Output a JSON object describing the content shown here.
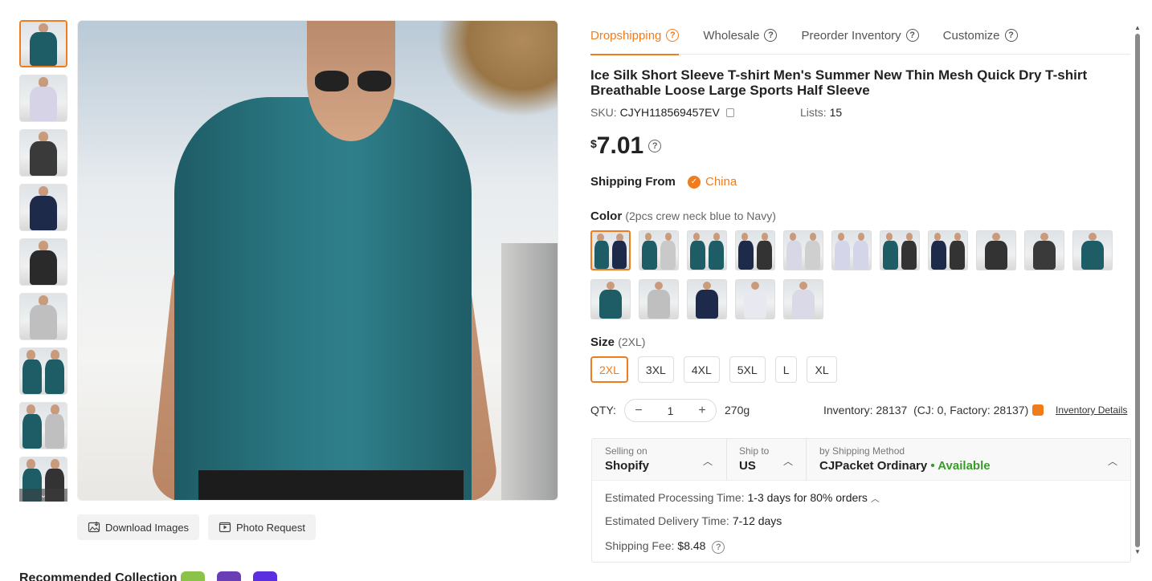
{
  "tabs": [
    {
      "label": "Dropshipping"
    },
    {
      "label": "Wholesale"
    },
    {
      "label": "Preorder Inventory"
    },
    {
      "label": "Customize"
    }
  ],
  "product": {
    "title": "Ice Silk Short Sleeve T-shirt Men's Summer New Thin Mesh Quick Dry T-shirt Breathable Loose Large Sports Half Sleeve",
    "sku_label": "SKU:",
    "sku": "CJYH118569457EV",
    "lists_label": "Lists:",
    "lists": "15",
    "currency": "$",
    "price": "7.01"
  },
  "shipping_from": {
    "label": "Shipping From",
    "country": "China"
  },
  "color": {
    "label": "Color",
    "selected": "(2pcs crew neck blue to Navy)"
  },
  "size": {
    "label": "Size",
    "selected": "(2XL)",
    "options": [
      "2XL",
      "3XL",
      "4XL",
      "5XL",
      "L",
      "XL"
    ]
  },
  "qty": {
    "label": "QTY:",
    "value": "1",
    "weight": "270g"
  },
  "inventory": {
    "text": "Inventory: 28137  (CJ: 0, Factory: 28137)",
    "details_link": "Inventory Details"
  },
  "shipping": {
    "selling_on_label": "Selling on",
    "selling_on": "Shopify",
    "ship_to_label": "Ship to",
    "ship_to": "US",
    "method_label": "by Shipping Method",
    "method": "CJPacket Ordinary",
    "availability": "• Available",
    "processing_label": "Estimated Processing Time:",
    "processing": "1-3 days for 80% orders",
    "delivery_label": "Estimated Delivery Time:",
    "delivery": "7-12 days",
    "fee_label": "Shipping Fee:",
    "fee": "$8.48"
  },
  "image_actions": {
    "download": "Download Images",
    "photo_request": "Photo Request"
  },
  "bottom": {
    "title": "Recommended Collection"
  },
  "colors": {
    "accent": "#f07c1b",
    "available": "#3a9a2b"
  },
  "swatch_colors": [
    [
      "#1e5c66",
      "#1e2a4a"
    ],
    [
      "#1e5c66",
      "#c9c9c9"
    ],
    [
      "#1e5c66",
      "#1e5c66"
    ],
    [
      "#1e2a4a",
      "#333333"
    ],
    [
      "#d7d7e6",
      "#cfcfcf"
    ],
    [
      "#d5d5ea",
      "#d5d5ea"
    ],
    [
      "#1e5c66",
      "#333333"
    ],
    [
      "#1e2a4a",
      "#333333"
    ],
    [
      "#333333"
    ],
    [
      "#3a3a3a"
    ],
    [
      "#1e5c66"
    ],
    [
      "#1e5c66"
    ],
    [
      "#bfbfbf"
    ],
    [
      "#1e2a4a"
    ],
    [
      "#e8e8f0"
    ],
    [
      "#d9d9e8"
    ]
  ],
  "thumb_colors": [
    [
      "#1e5c66"
    ],
    [
      "#d7d3e6"
    ],
    [
      "#3a3a3a"
    ],
    [
      "#1e2a4a"
    ],
    [
      "#2a2a2a"
    ],
    [
      "#bfbfbf"
    ],
    [
      "#1e5c66",
      "#1e5c66"
    ],
    [
      "#1e5c66",
      "#bfbfbf"
    ],
    [
      "#1e5c66",
      "#333333"
    ]
  ]
}
